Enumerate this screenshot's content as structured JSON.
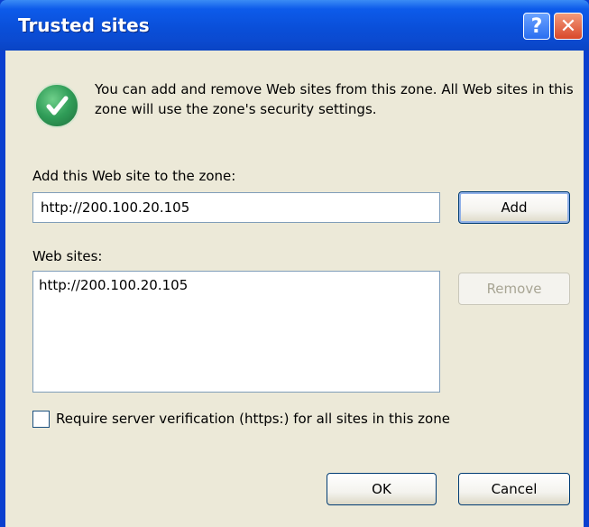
{
  "dialog": {
    "title": "Trusted sites",
    "help_glyph": "?",
    "close_glyph": "✕",
    "message": "You can add and remove Web sites from this zone. All Web sites in this zone will use the zone's security settings."
  },
  "add_section": {
    "label": "Add this Web site to the zone:",
    "input_value": "http://200.100.20.105",
    "add_label": "Add"
  },
  "sites_section": {
    "label": "Web sites:",
    "items": [
      "http://200.100.20.105"
    ],
    "remove_label": "Remove"
  },
  "verification": {
    "label": "Require server verification (https:) for all sites in this zone",
    "checked": false
  },
  "footer": {
    "ok_label": "OK",
    "cancel_label": "Cancel"
  },
  "colors": {
    "titlebar": "#0a4fd9",
    "dialog_background": "#ece9d8",
    "check_icon": "#2f9c57"
  }
}
